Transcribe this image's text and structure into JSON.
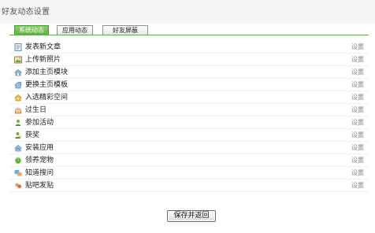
{
  "title": "好友动态设置",
  "tabs": [
    {
      "label": "系统动态",
      "active": true
    },
    {
      "label": "应用动态",
      "active": false
    },
    {
      "label": "好友屏蔽",
      "active": false
    }
  ],
  "items": [
    {
      "label": "发表新文章",
      "link": "设置",
      "icon": "article-icon"
    },
    {
      "label": "上传新照片",
      "link": "设置",
      "icon": "photo-icon"
    },
    {
      "label": "添加主页模块",
      "link": "设置",
      "icon": "module-add-icon"
    },
    {
      "label": "更换主页模板",
      "link": "设置",
      "icon": "template-icon"
    },
    {
      "label": "入选精彩空间",
      "link": "设置",
      "icon": "home-award-icon"
    },
    {
      "label": "过生日",
      "link": "设置",
      "icon": "birthday-cake-icon"
    },
    {
      "label": "参加活动",
      "link": "设置",
      "icon": "event-person-icon"
    },
    {
      "label": "获奖",
      "link": "设置",
      "icon": "award-person-icon"
    },
    {
      "label": "安装应用",
      "link": "设置",
      "icon": "app-install-icon"
    },
    {
      "label": "领养宠物",
      "link": "设置",
      "icon": "pet-icon"
    },
    {
      "label": "知道搜问",
      "link": "设置",
      "icon": "qa-icon"
    },
    {
      "label": "贴吧发贴",
      "link": "设置",
      "icon": "forum-post-icon"
    }
  ],
  "save_button": "保存并返回",
  "colors": {
    "tab_active": "#5eaa43",
    "tab_border": "#5fa94a",
    "link_text": "#888888"
  }
}
